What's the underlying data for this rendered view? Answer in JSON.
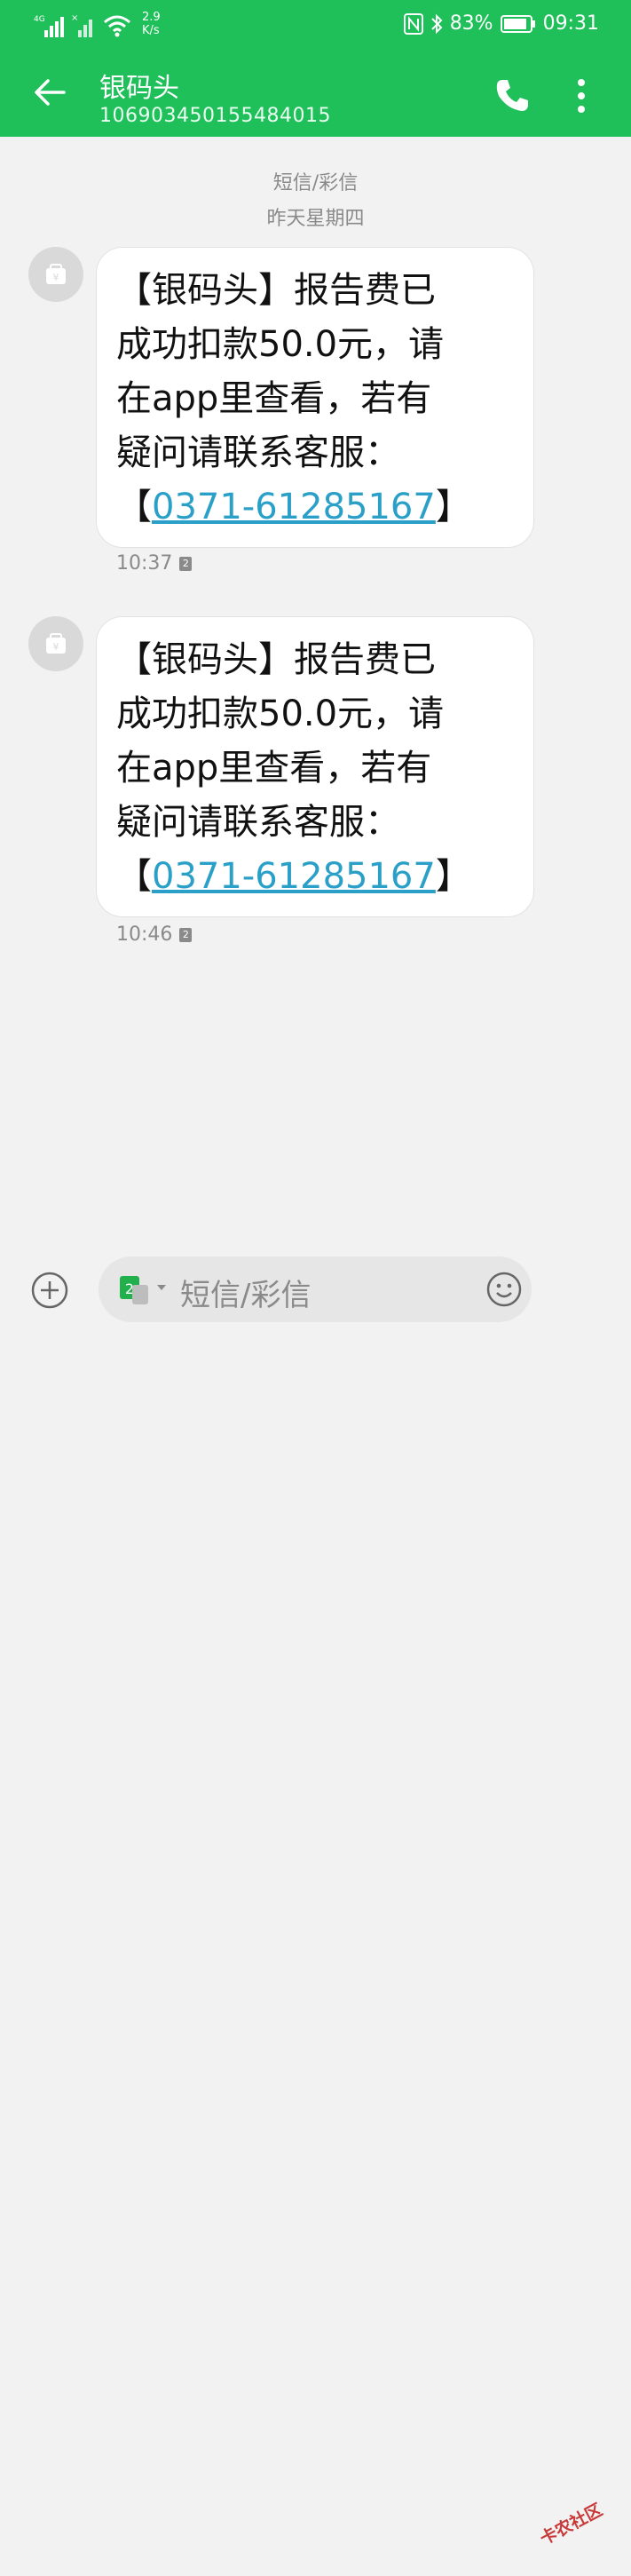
{
  "status_bar": {
    "network": "4G",
    "speed_value": "2.9",
    "speed_unit": "K/s",
    "battery": "83%",
    "time": "09:31",
    "icons": [
      "signal-icon",
      "signal-no-sim-icon",
      "wifi-icon",
      "nfc-icon",
      "bluetooth-icon",
      "battery-icon"
    ]
  },
  "header": {
    "title": "银码头",
    "number": "106903450155484015",
    "icons": [
      "back-arrow-icon",
      "phone-icon",
      "more-vert-icon"
    ]
  },
  "conversation": {
    "type_label": "短信/彩信",
    "day_label": "昨天星期四"
  },
  "messages": [
    {
      "text_lines": [
        "【银码头】报告费已",
        "成功扣款50.0元，请",
        "在app里查看，若有",
        "疑问请联系客服："
      ],
      "link_prefix": "【",
      "link": "0371-61285167",
      "link_suffix": "】",
      "time": "10:37",
      "sim": "2"
    },
    {
      "text_lines": [
        "【银码头】报告费已",
        "成功扣款50.0元，请",
        "在app里查看，若有",
        "疑问请联系客服："
      ],
      "link_prefix": "【",
      "link": "0371-61285167",
      "link_suffix": "】",
      "time": "10:46",
      "sim": "2"
    }
  ],
  "composer": {
    "placeholder": "短信/彩信",
    "sim_label": "2",
    "icons": [
      "add-icon",
      "sim-switch-icon",
      "emoji-icon"
    ]
  },
  "watermark": {
    "text": "卡农社区"
  },
  "colors": {
    "header_green": "#1fbf5a",
    "link_blue": "#2aa0c9",
    "background": "#f2f2f2"
  }
}
